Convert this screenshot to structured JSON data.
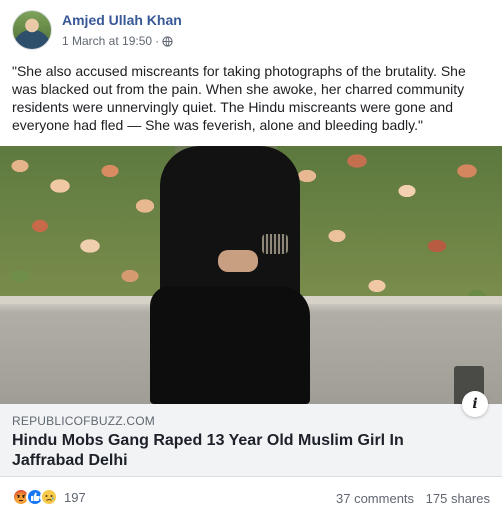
{
  "post": {
    "author": "Amjed Ullah Khan",
    "timestamp": "1 March at 19:50",
    "separator": "·",
    "privacy_icon": "globe-icon",
    "text": "\"She also accused miscreants for taking photographs of the brutality. She was blacked out from the pain. When she awoke, her charred community residents were unnervingly quiet. The Hindu miscreants were gone and everyone had fled — She was feverish, alone and bleeding badly.\""
  },
  "link_preview": {
    "domain": "REPUBLICOFBUZZ.COM",
    "headline": "Hindu Mobs Gang Raped 13 Year Old Muslim Girl In Jaffrabad Delhi",
    "info_label": "i"
  },
  "footer": {
    "reactions": [
      "angry-reaction-icon",
      "like-reaction-icon",
      "sad-reaction-icon"
    ],
    "reaction_count": "197",
    "comments": "37 comments",
    "shares": "175 shares"
  },
  "colors": {
    "author_link": "#385898",
    "secondary_text": "#606770",
    "link_box_bg": "#f2f3f5",
    "like_blue": "#1877f2"
  }
}
